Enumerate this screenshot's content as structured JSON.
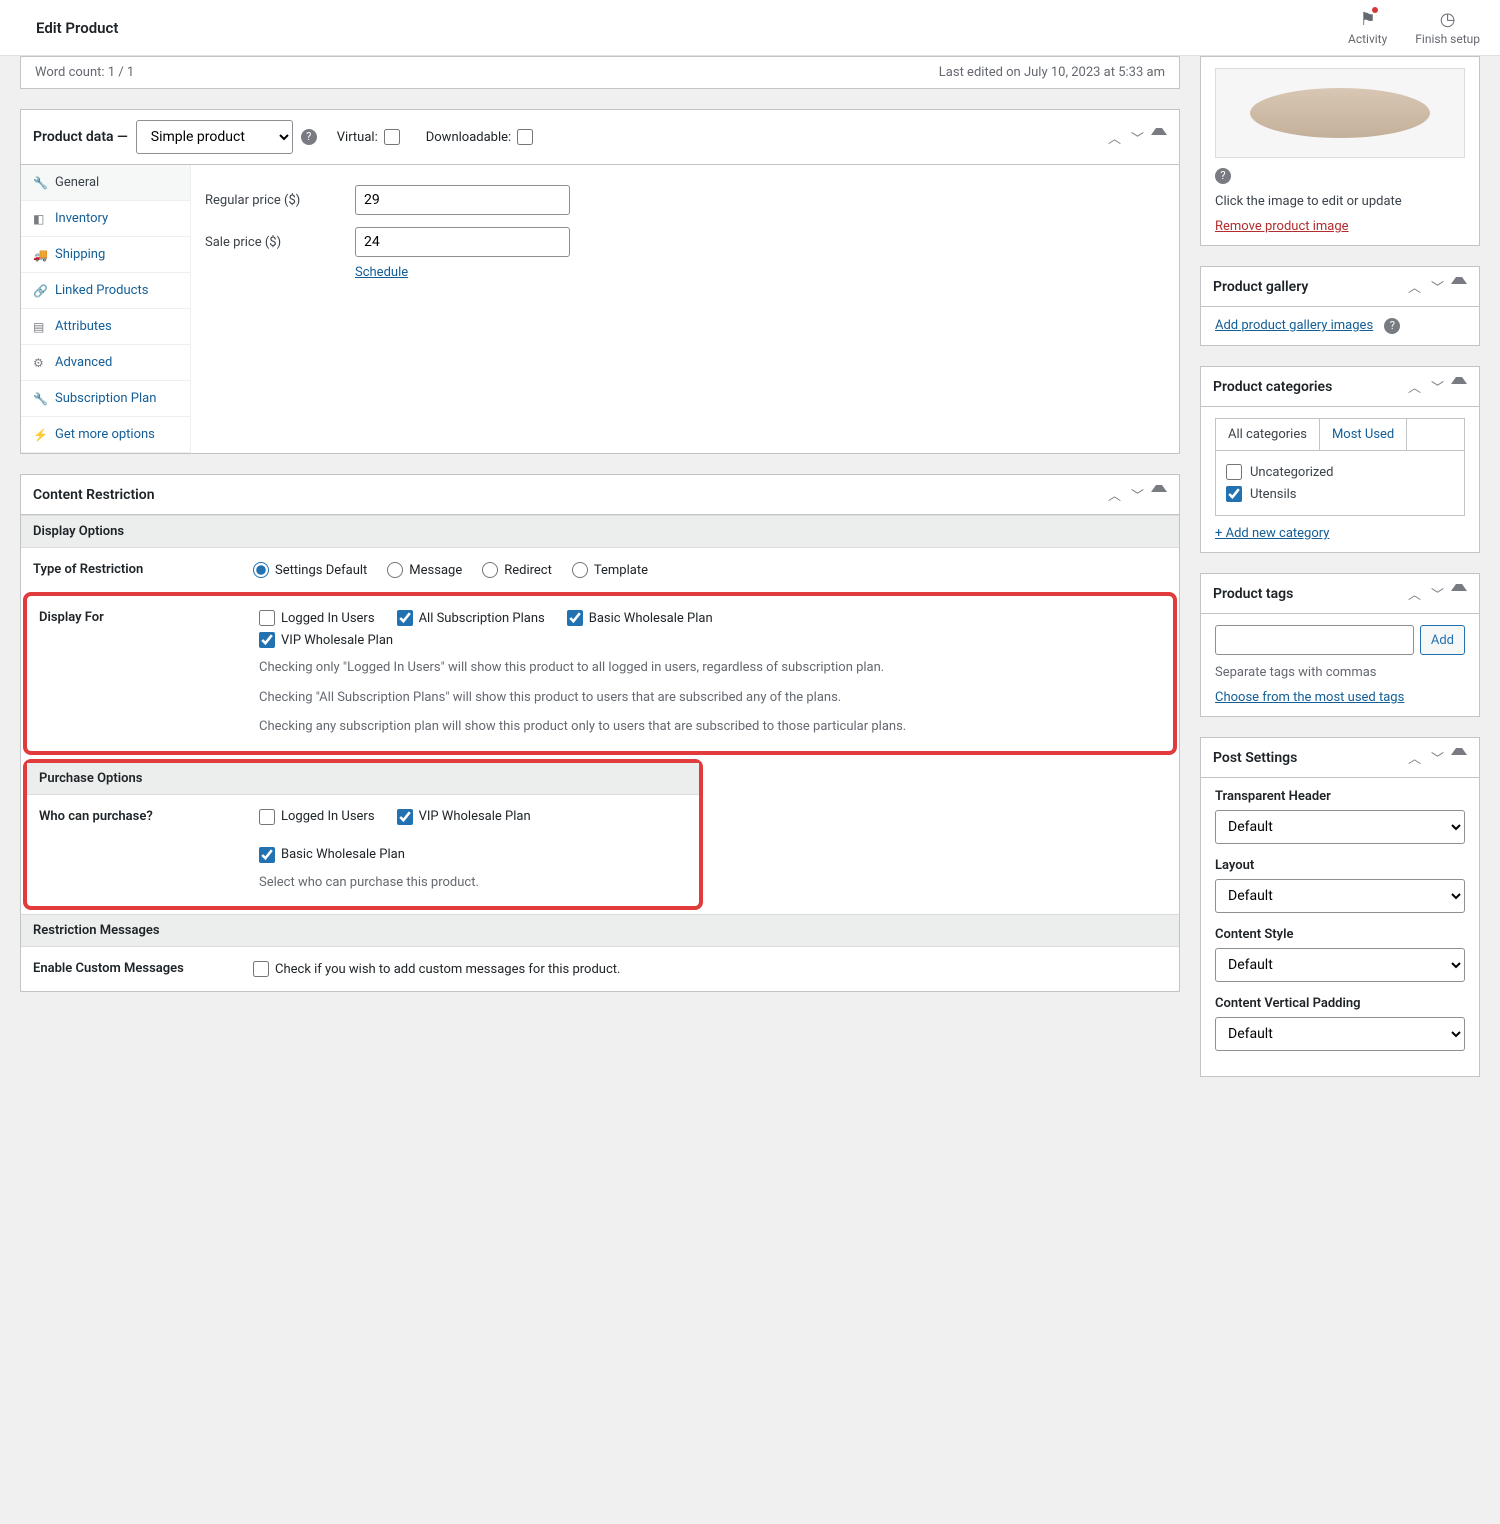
{
  "topbar": {
    "title": "Edit Product",
    "activity": "Activity",
    "finish": "Finish setup"
  },
  "editor_meta": {
    "left": "Word count: 1 / 1",
    "right": "Last edited on July 10, 2023 at 5:33 am"
  },
  "product_data": {
    "label": "Product data —",
    "type": "Simple product",
    "virtual": "Virtual:",
    "downloadable": "Downloadable:",
    "tabs": [
      "General",
      "Inventory",
      "Shipping",
      "Linked Products",
      "Attributes",
      "Advanced",
      "Subscription Plan",
      "Get more options"
    ],
    "regular_price_label": "Regular price ($)",
    "regular_price": "29",
    "sale_price_label": "Sale price ($)",
    "sale_price": "24",
    "schedule": "Schedule"
  },
  "content_restriction": {
    "title": "Content Restriction",
    "display_options": "Display Options",
    "type_label": "Type of Restriction",
    "type_options": [
      "Settings Default",
      "Message",
      "Redirect",
      "Template"
    ],
    "display_for": {
      "label": "Display For",
      "options": [
        "Logged In Users",
        "All Subscription Plans",
        "Basic Wholesale Plan",
        "VIP Wholesale Plan"
      ],
      "help1": "Checking only \"Logged In Users\" will show this product to all logged in users, regardless of subscription plan.",
      "help2": "Checking \"All Subscription Plans\" will show this product to users that are subscribed any of the plans.",
      "help3": "Checking any subscription plan will show this product only to users that are subscribed to those particular plans."
    },
    "purchase": {
      "header": "Purchase Options",
      "label": "Who can purchase?",
      "options": [
        "Logged In Users",
        "VIP Wholesale Plan",
        "Basic Wholesale Plan"
      ],
      "help": "Select who can purchase this product."
    },
    "messages_header": "Restriction Messages",
    "enable_custom_label": "Enable Custom Messages",
    "enable_custom_text": "Check if you wish to add custom messages for this product."
  },
  "side": {
    "image": {
      "caption": "Click the image to edit or update",
      "remove": "Remove product image"
    },
    "gallery": {
      "title": "Product gallery",
      "add": "Add product gallery images"
    },
    "categories": {
      "title": "Product categories",
      "tab1": "All categories",
      "tab2": "Most Used",
      "cat1": "Uncategorized",
      "cat2": "Utensils",
      "add": "+ Add new category"
    },
    "tags": {
      "title": "Product tags",
      "add_btn": "Add",
      "sep": "Separate tags with commas",
      "choose": "Choose from the most used tags"
    },
    "post": {
      "title": "Post Settings",
      "transparent": "Transparent Header",
      "layout": "Layout",
      "content_style": "Content Style",
      "padding": "Content Vertical Padding",
      "default": "Default"
    }
  }
}
